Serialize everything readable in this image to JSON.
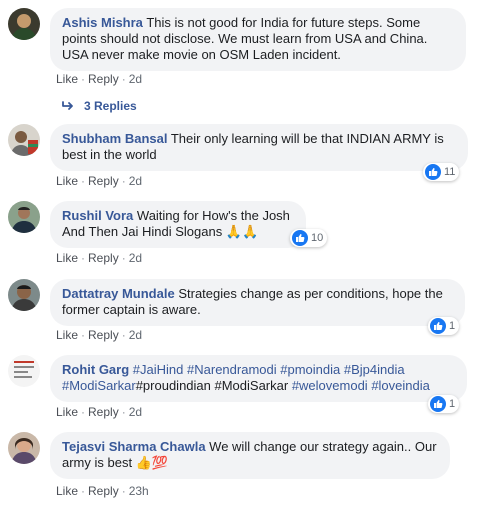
{
  "actions": {
    "like": "Like",
    "reply": "Reply",
    "sep": "·"
  },
  "replies": {
    "label": "3 Replies"
  },
  "comments": [
    {
      "name": "Ashis Mishra",
      "text": "This is not good for India for future steps. Some points should not disclose. We must learn from USA and China. USA never make movie on OSM Laden incident.",
      "time": "2d"
    },
    {
      "name": "Shubham Bansal",
      "text": "Their only learning will be that INDIAN ARMY is best in the world",
      "time": "2d",
      "reactions": "11"
    },
    {
      "name": "Rushil Vora",
      "text": "Waiting for How's the Josh And Then Jai Hindi Slogans",
      "emoji": "🙏🙏",
      "time": "2d",
      "reactions": "10"
    },
    {
      "name": "Dattatray Mundale",
      "text": "Strategies change as per conditions, hope the former captain is aware.",
      "time": "2d",
      "reactions": "1"
    },
    {
      "name": "Rohit Garg",
      "tags": [
        "#JaiHind",
        "#Narendramodi",
        "#pmoindia",
        "#Bjp4india",
        "#ModiSarkar"
      ],
      "plain": "#proudindian #ModiSarkar",
      "tags2": [
        "#welovemodi",
        "#loveindia"
      ],
      "time": "2d",
      "reactions": "1"
    },
    {
      "name": "Tejasvi Sharma Chawla",
      "text": "We will change our strategy again.. Our army is best",
      "emoji": "👍💯",
      "time": "23h"
    }
  ],
  "colors": {
    "link": "#385898",
    "bubble": "#f2f3f5",
    "like": "#1877f2",
    "meta": "#606770"
  }
}
